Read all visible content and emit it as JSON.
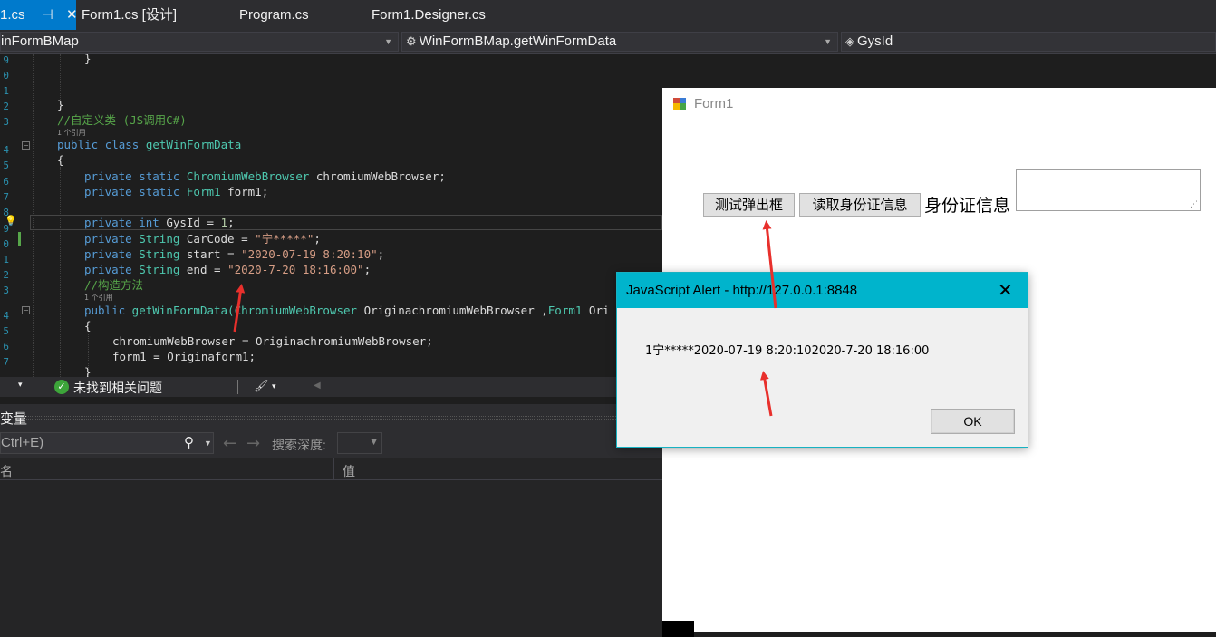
{
  "tabs": [
    {
      "label": "1.cs",
      "pin": "⊣",
      "close": "✕"
    },
    {
      "label": "Form1.cs [设计]"
    },
    {
      "label": "Program.cs"
    },
    {
      "label": "Form1.Designer.cs"
    }
  ],
  "nav": {
    "project": "inFormBMap",
    "member": "WinFormBMap.getWinFormData",
    "field": "GysId"
  },
  "code": {
    "line_numbers": [
      "9",
      "0",
      "1",
      "2",
      "3",
      "4",
      "5",
      "6",
      "7",
      "8",
      "9",
      "0",
      "1",
      "2",
      "3",
      "4",
      "5",
      "6",
      "7"
    ],
    "refs": "1 个引用",
    "refs2": "1 个引用",
    "l_close1": "}",
    "l_close2": "}",
    "l_comment_custom": "//自定义类 (JS调用C#)",
    "l_public": "public",
    "l_class": "class",
    "l_classname": "getWinFormData",
    "l_open1": "{",
    "l_private": "private",
    "l_static": "static",
    "l_chromium_type": "ChromiumWebBrowser",
    "l_chromium_var": " chromiumWebBrowser;",
    "l_form1_type": "Form1",
    "l_form1_var": " form1;",
    "l_int": "int",
    "l_gysid": " GysId = ",
    "l_gysid_val": "1",
    "l_semicolon": ";",
    "l_string": "String",
    "l_carcode": " CarCode = ",
    "l_carcode_val": "\"宁*****\"",
    "l_start": " start = ",
    "l_start_val": "\"2020-07-19 8:20:10\"",
    "l_end": " end = ",
    "l_end_val": "\"2020-7-20 18:16:00\"",
    "l_comment_ctor": "//构造方法",
    "l_ctor_name": " getWinFormData(",
    "l_ctor_type1": "ChromiumWebBrowser",
    "l_ctor_param1": " OriginachromiumWebBrowser ,",
    "l_ctor_type2": "Form1",
    "l_ctor_param2": " Ori",
    "l_open2": "{",
    "l_assign1": "chromiumWebBrowser = OriginachromiumWebBrowser;",
    "l_assign2": "form1 = Originaform1;",
    "l_close3": "}"
  },
  "status": {
    "no_issues": "未找到相关问题",
    "check_icon": "✓",
    "brush_icon": "🖌",
    "dropdown": "▾"
  },
  "variables": {
    "title": "变量",
    "search_placeholder": "Ctrl+E)",
    "depth_label": "搜索深度:",
    "col_name": "名",
    "col_value": "值"
  },
  "form": {
    "title": "Form1",
    "btn_alert": "测试弹出框",
    "btn_read": "读取身份证信息",
    "id_label": "身份证信息"
  },
  "dialog": {
    "title": "JavaScript Alert - http://127.0.0.1:8848",
    "message": "1宁*****2020-07-19 8:20:102020-7-20 18:16:00",
    "ok": "OK",
    "close": "✕"
  },
  "colors": {
    "accent": "#007acc",
    "dialog_header": "#00b4cc",
    "annotation_arrow": "#e8302c"
  }
}
